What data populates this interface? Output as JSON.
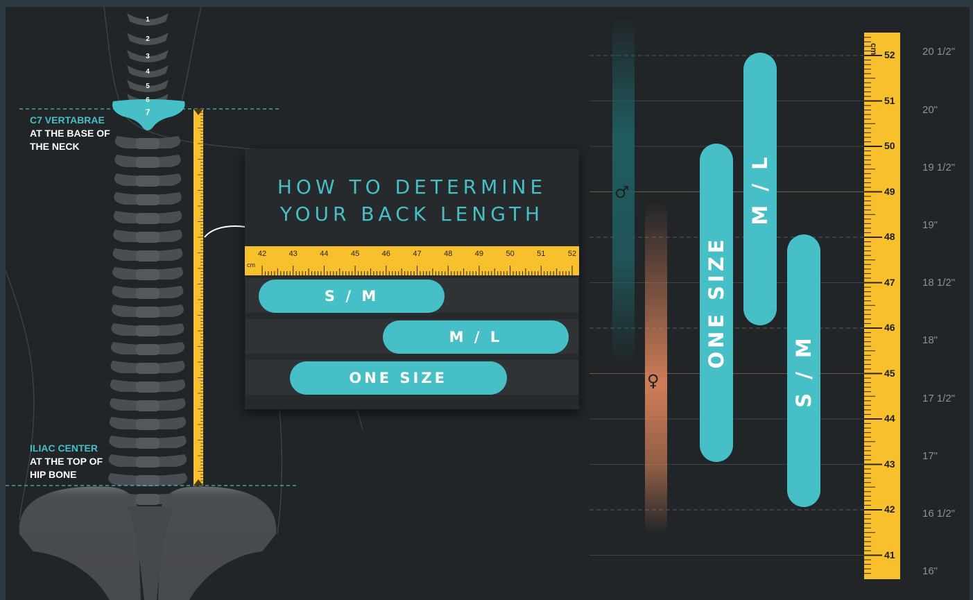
{
  "spine": {
    "vertebra_numbers": [
      "1",
      "2",
      "3",
      "4",
      "5",
      "6",
      "7"
    ],
    "top_label": {
      "accent": "C7 VERTABRAE",
      "line1": "AT THE BASE OF",
      "line2": "THE NECK"
    },
    "bottom_label": {
      "accent": "ILIAC CENTER",
      "line1": "AT THE TOP OF",
      "line2": "HIP BONE"
    }
  },
  "panel": {
    "title_line1": "HOW TO DETERMINE",
    "title_line2": "YOUR BACK LENGTH",
    "ruler_unit": "cm",
    "ruler_ticks": [
      "42",
      "43",
      "44",
      "45",
      "46",
      "47",
      "48",
      "49",
      "50",
      "51",
      "52"
    ],
    "sizes": [
      {
        "label": "S / M",
        "min_cm": 42.0,
        "max_cm": 48.0
      },
      {
        "label": "M / L",
        "min_cm": 46.0,
        "max_cm": 52.0
      },
      {
        "label": "ONE SIZE",
        "min_cm": 43.0,
        "max_cm": 50.0
      }
    ]
  },
  "chart": {
    "unit": "cm",
    "cm_ticks": [
      "52",
      "51",
      "50",
      "49",
      "48",
      "47",
      "46",
      "45",
      "44",
      "43",
      "42",
      "41"
    ],
    "inch_labels": [
      "20 1/2\"",
      "20\"",
      "19 1/2\"",
      "19\"",
      "18 1/2\"",
      "18\"",
      "17 1/2\"",
      "17\"",
      "16 1/2\"",
      "16\""
    ],
    "male_symbol": "♂",
    "female_symbol": "♀",
    "male_avg_cm": 49,
    "female_avg_cm": 45,
    "sizes": [
      {
        "label": "ONE SIZE",
        "min_cm": 43.0,
        "max_cm": 50.0
      },
      {
        "label": "M / L",
        "min_cm": 46.0,
        "max_cm": 52.0
      },
      {
        "label": "S / M",
        "min_cm": 42.0,
        "max_cm": 48.0
      }
    ],
    "colors": {
      "accent": "#47bfc6",
      "ruler": "#f9c02e",
      "male": "#1f5f63",
      "female": "#d8825a"
    }
  }
}
